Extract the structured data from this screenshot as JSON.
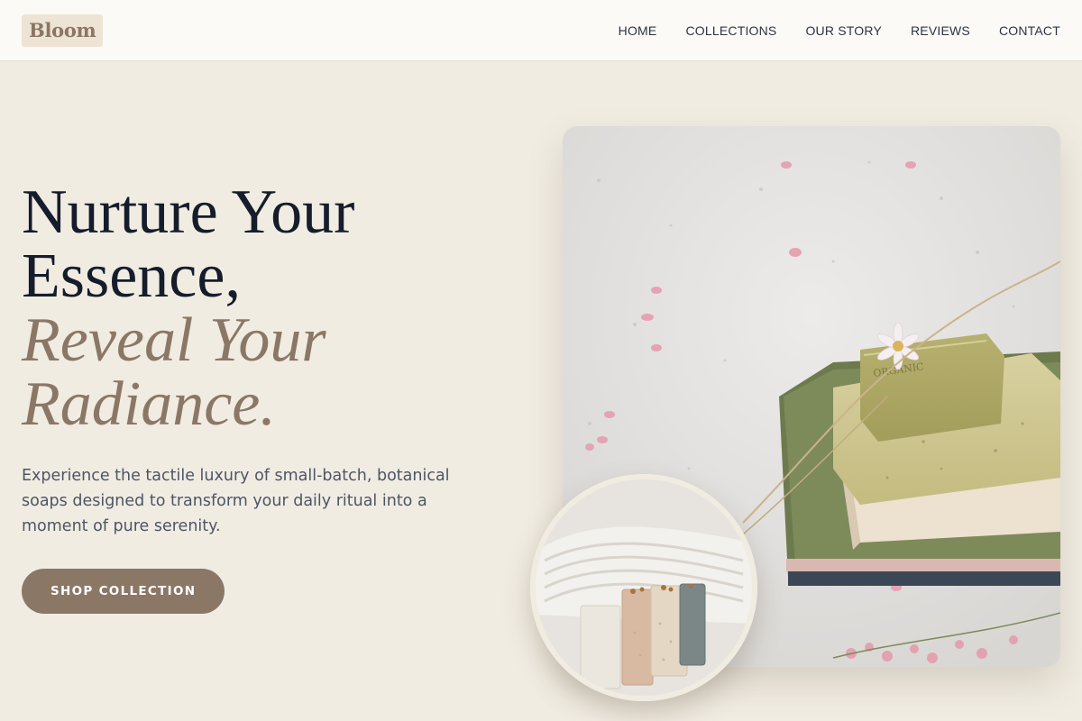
{
  "brand": {
    "logo_text": "Bloom"
  },
  "nav": {
    "items": [
      {
        "label": "HOME"
      },
      {
        "label": "COLLECTIONS"
      },
      {
        "label": "OUR STORY"
      },
      {
        "label": "REVIEWS"
      },
      {
        "label": "CONTACT"
      }
    ]
  },
  "hero": {
    "headline_line1": "Nurture Your",
    "headline_line2": "Essence,",
    "headline_line3": "Reveal Your",
    "headline_line4": "Radiance.",
    "subtext": "Experience the tactile luxury of small-batch, botanical soaps designed to transform your daily ritual into a moment of pure serenity.",
    "cta_label": "SHOP COLLECTION"
  },
  "colors": {
    "background": "#f1ece2",
    "accent": "#8b7766",
    "heading": "#151c2b"
  }
}
